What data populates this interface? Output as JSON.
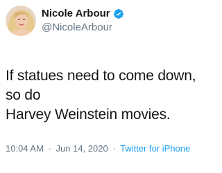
{
  "author": {
    "display_name": "Nicole Arbour",
    "handle": "@NicoleArbour",
    "verified": true,
    "avatar_icon": "profile-photo"
  },
  "tweet": {
    "line1": "If statues need to come down, so do",
    "line2": "Harvey Weinstein movies."
  },
  "meta": {
    "time": "10:04 AM",
    "separator1": "·",
    "date": "Jun 14, 2020",
    "separator2": "·",
    "source": "Twitter for iPhone"
  },
  "colors": {
    "verified_badge": "#1da1f2",
    "link": "#1da1f2",
    "secondary_text": "#657786",
    "primary_text": "#14171a"
  }
}
